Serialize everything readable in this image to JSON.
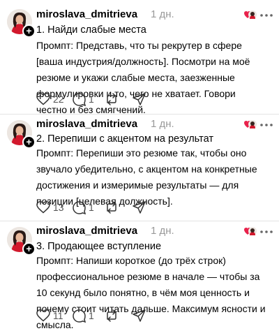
{
  "icons": {
    "avatar": "avatar-icon",
    "plus": "plus-icon",
    "heart_emoji": "heart-emoji-icon",
    "more": "more-icon",
    "like": "heart-icon",
    "reply": "comment-icon",
    "repost": "repost-icon",
    "share": "share-icon"
  },
  "colors": {
    "text": "#000000",
    "muted": "#999999",
    "counts": "#555555",
    "divider": "#e3e3e3",
    "heart": "#e8214b"
  },
  "posts": [
    {
      "username": "miroslava_dmitrieva",
      "time": "1 дн.",
      "title": "1. Найди слабые места",
      "body": "Промпт: Представь, что ты рекрутер в сфере [ваша индустрия/должность]. Посмотри на моё резюме и укажи слабые места, заезженные формулировки и то, чего не хватает. Говори честно и без смягчений.",
      "likes": "22",
      "replies": "1"
    },
    {
      "username": "miroslava_dmitrieva",
      "time": "1 дн.",
      "title": "2. Перепиши с акцентом на результат",
      "body": "Промпт: Перепиши это резюме так, чтобы оно звучало убедительно, с акцентом на конкретные достижения и измеримые результаты — для позиции [целевая должность].",
      "likes": "13",
      "replies": "1"
    },
    {
      "username": "miroslava_dmitrieva",
      "time": "1 дн.",
      "title": "3. Продающее вступление",
      "body": "Промпт: Напиши короткое (до трёх строк) профессиональное резюме в начале — чтобы за 10 секунд было понятно, в чём моя ценность и почему стоит читать дальше. Максимум ясности и смысла.",
      "likes": "11",
      "replies": "1"
    }
  ]
}
